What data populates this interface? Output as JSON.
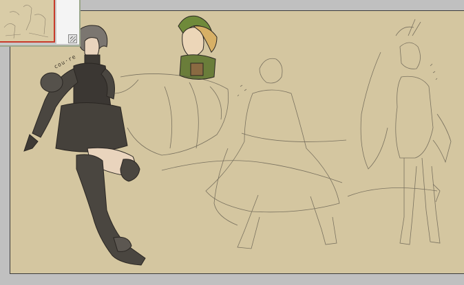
{
  "canvas": {
    "signature": "cou·re",
    "colors": {
      "canvas_bg": "#d4c6a0",
      "workspace_bg": "#c0c0c0",
      "navigator_border": "#9aa68a",
      "viewport_indicator": "#c83a2a",
      "sketch_line": "#5a5448",
      "armor": "#4a4640",
      "skin": "#e9d4bd"
    }
  },
  "navigator": {
    "icons": {
      "resize": "resize-grip-icon"
    }
  }
}
